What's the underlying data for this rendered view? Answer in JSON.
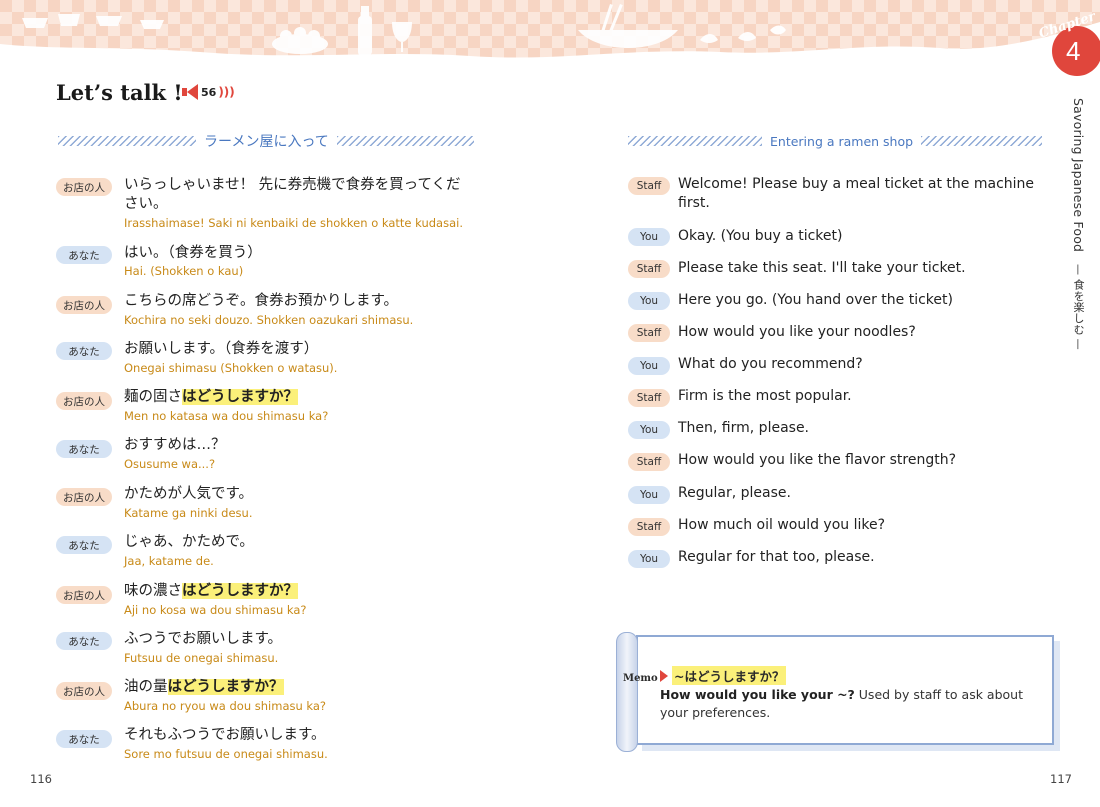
{
  "header": {
    "chapter_word": "Chapter",
    "chapter_number": "4",
    "side_title_en": "Savoring Japanese Food",
    "side_title_jp": "— 食を楽しむ —"
  },
  "section": {
    "title": "Let’s talk !",
    "audio_track": "56",
    "jp_heading": "ラーメン屋に入って",
    "en_heading": "Entering a ramen shop"
  },
  "dialogue_jp": [
    {
      "speaker": "お店の人",
      "line_pre": "いらっしゃいませ！ 先に券売機で食券を買ってください。",
      "line_hl": "",
      "line_post": "",
      "romaji": "Irasshaimase! Saki ni kenbaiki de shokken o katte kudasai."
    },
    {
      "speaker": "あなた",
      "line_pre": "はい。（食券を買う）",
      "line_hl": "",
      "line_post": "",
      "romaji": "Hai. (Shokken o kau)"
    },
    {
      "speaker": "お店の人",
      "line_pre": "こちらの席どうぞ。食券お預かりします。",
      "line_hl": "",
      "line_post": "",
      "romaji": "Kochira no seki douzo. Shokken oazukari shimasu."
    },
    {
      "speaker": "あなた",
      "line_pre": "お願いします。（食券を渡す）",
      "line_hl": "",
      "line_post": "",
      "romaji": "Onegai shimasu (Shokken o watasu)."
    },
    {
      "speaker": "お店の人",
      "line_pre": "麺の固さ",
      "line_hl": "はどうしますか？",
      "line_post": "",
      "romaji": "Men no katasa wa dou shimasu ka?"
    },
    {
      "speaker": "あなた",
      "line_pre": "おすすめは…？",
      "line_hl": "",
      "line_post": "",
      "romaji": "Osusume wa...?"
    },
    {
      "speaker": "お店の人",
      "line_pre": "かためが人気です。",
      "line_hl": "",
      "line_post": "",
      "romaji": "Katame ga ninki desu."
    },
    {
      "speaker": "あなた",
      "line_pre": "じゃあ、かためで。",
      "line_hl": "",
      "line_post": "",
      "romaji": "Jaa, katame de."
    },
    {
      "speaker": "お店の人",
      "line_pre": "味の濃さ",
      "line_hl": "はどうしますか？",
      "line_post": "",
      "romaji": "Aji no kosa wa dou shimasu ka?"
    },
    {
      "speaker": "あなた",
      "line_pre": "ふつうでお願いします。",
      "line_hl": "",
      "line_post": "",
      "romaji": "Futsuu de onegai shimasu."
    },
    {
      "speaker": "お店の人",
      "line_pre": "油の量",
      "line_hl": "はどうしますか？",
      "line_post": "",
      "romaji": "Abura no ryou wa dou shimasu ka?"
    },
    {
      "speaker": "あなた",
      "line_pre": "それもふつうでお願いします。",
      "line_hl": "",
      "line_post": "",
      "romaji": "Sore mo futsuu de onegai shimasu."
    }
  ],
  "dialogue_en": [
    {
      "speaker": "Staff",
      "text": "Welcome! Please buy a meal ticket at the machine first."
    },
    {
      "speaker": "You",
      "text": "Okay. (You buy a ticket)"
    },
    {
      "speaker": "Staff",
      "text": "Please take this seat. I'll take your ticket."
    },
    {
      "speaker": "You",
      "text": "Here you go. (You hand over the ticket)"
    },
    {
      "speaker": "Staff",
      "text": "How would you like your noodles?"
    },
    {
      "speaker": "You",
      "text": "What do you recommend?"
    },
    {
      "speaker": "Staff",
      "text": "Firm is the most popular."
    },
    {
      "speaker": "You",
      "text": "Then, firm, please."
    },
    {
      "speaker": "Staff",
      "text": "How would you like the flavor strength?"
    },
    {
      "speaker": "You",
      "text": "Regular, please."
    },
    {
      "speaker": "Staff",
      "text": "How much oil would you like?"
    },
    {
      "speaker": "You",
      "text": "Regular for that too, please."
    }
  ],
  "memo": {
    "label": "Memo",
    "title": "~はどうしますか？",
    "body_bold": "How would you like your ~?",
    "body_rest": " Used by staff to ask about your preferences."
  },
  "pages": {
    "left": "116",
    "right": "117"
  },
  "colors": {
    "accent_red": "#e0463c",
    "heading_blue": "#4a78c0",
    "romaji_gold": "#c88a18",
    "staff_tag": "#f8dcc8",
    "you_tag": "#d5e3f4",
    "highlight": "#fbf07a"
  },
  "icons": {
    "audio": "speaker-icon",
    "banner": "food-illustration-banner"
  }
}
